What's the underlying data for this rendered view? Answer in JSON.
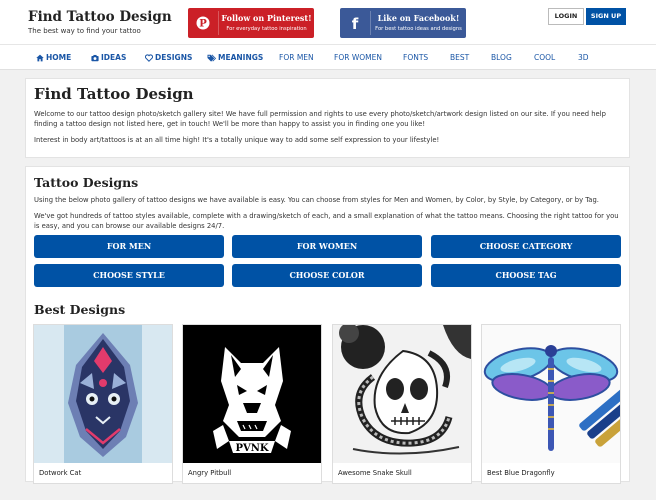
{
  "header": {
    "site_title": "Find Tattoo Design",
    "tagline": "The best way to find your tattoo",
    "pinterest": {
      "title": "Follow on Pinterest!",
      "subtitle": "For everyday tattoo inspiration",
      "color": "#cb2027"
    },
    "facebook": {
      "title": "Like on Facebook!",
      "subtitle": "For best tattoo ideas and designs",
      "color": "#3b5998"
    },
    "login_label": "LOGIN",
    "signup_label": "SIGN UP"
  },
  "nav": {
    "items": [
      {
        "label": "HOME",
        "icon": "home-icon"
      },
      {
        "label": "IDEAS",
        "icon": "camera-icon"
      },
      {
        "label": "DESIGNS",
        "icon": "heart-icon"
      },
      {
        "label": "MEANINGS",
        "icon": "tags-icon"
      },
      {
        "label": "FOR MEN"
      },
      {
        "label": "FOR WOMEN"
      },
      {
        "label": "FONTS"
      },
      {
        "label": "BEST"
      },
      {
        "label": "BLOG"
      },
      {
        "label": "COOL"
      },
      {
        "label": "3D"
      }
    ]
  },
  "intro": {
    "title": "Find Tattoo Design",
    "para1": "Welcome to our tattoo design photo/sketch gallery site! We have full permission and rights to use every photo/sketch/artwork design listed on our site. If you need help finding a tattoo design not listed here, get in touch! We'll be more than happy to assist you in finding one you like!",
    "para2": "Interest in body art/tattoos is at an all time high! It's a totally unique way to add some self expression to your lifestyle!"
  },
  "designs": {
    "title": "Tattoo Designs",
    "para1": "Using the below photo gallery of tattoo designs we have available is easy. You can choose from styles for Men and Women, by Color, by Style, by Category, or by Tag.",
    "para2": "We've got hundreds of tattoo styles available, complete with a drawing/sketch of each, and a small explanation of what the tattoo means. Choosing the right tattoo for you is easy, and you can browse our available designs 24/7.",
    "buttons": [
      "FOR MEN",
      "FOR WOMEN",
      "CHOOSE CATEGORY",
      "CHOOSE STYLE",
      "CHOOSE COLOR",
      "CHOOSE TAG"
    ]
  },
  "best": {
    "title": "Best Designs",
    "items": [
      {
        "caption": "Dotwork Cat"
      },
      {
        "caption": "Angry Pitbull"
      },
      {
        "caption": "Awesome Snake Skull"
      },
      {
        "caption": "Best Blue Dragonfly"
      }
    ]
  },
  "colors": {
    "accent": "#0052a5",
    "nav_link": "#1a56a6",
    "background": "#f1f1f1"
  }
}
